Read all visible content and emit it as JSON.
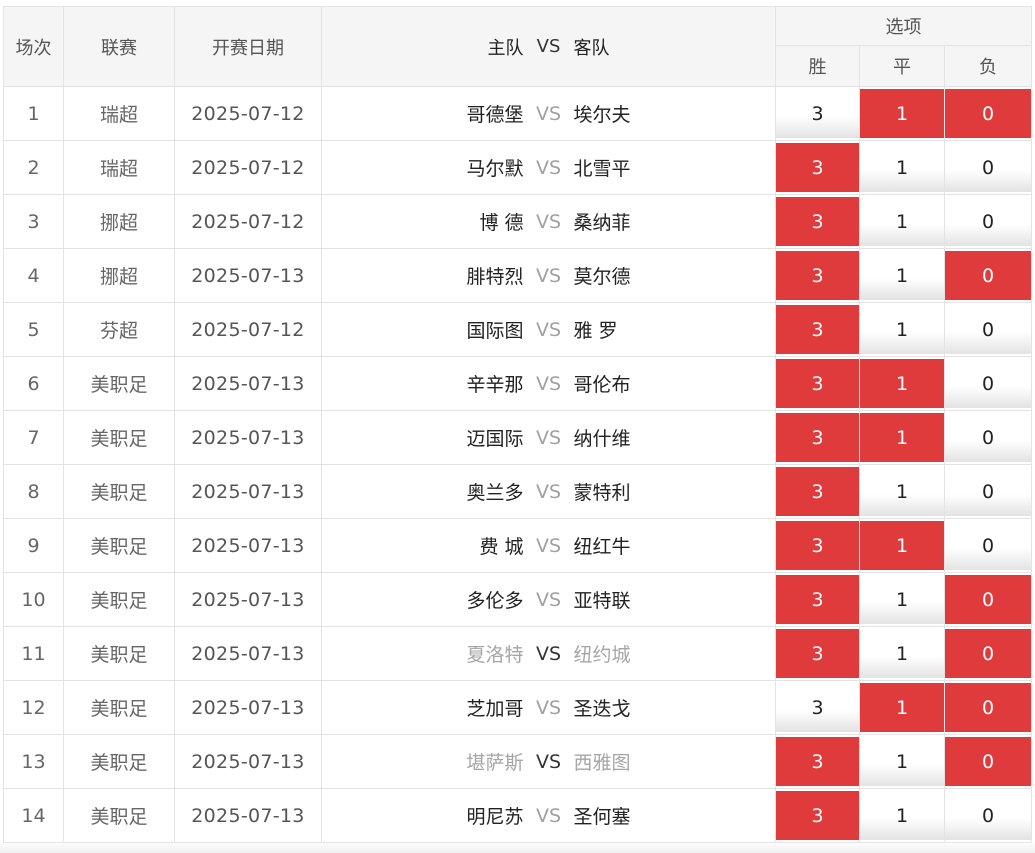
{
  "header": {
    "round": "场次",
    "league": "联赛",
    "date": "开赛日期",
    "home": "主队",
    "vs": "VS",
    "away": "客队",
    "options": "选项",
    "win": "胜",
    "draw": "平",
    "lose": "负"
  },
  "option_values": {
    "win": "3",
    "draw": "1",
    "lose": "0"
  },
  "colors": {
    "selected": "#df3b3c",
    "muted_team": "#a6a6a6"
  },
  "matches": [
    {
      "no": "1",
      "league": "瑞超",
      "date": "2025-07-12",
      "home": "哥德堡",
      "vs": "VS",
      "away": "埃尔夫",
      "muted": false,
      "selected": [
        "1",
        "0"
      ]
    },
    {
      "no": "2",
      "league": "瑞超",
      "date": "2025-07-12",
      "home": "马尔默",
      "vs": "VS",
      "away": "北雪平",
      "muted": false,
      "selected": [
        "3"
      ]
    },
    {
      "no": "3",
      "league": "挪超",
      "date": "2025-07-12",
      "home": "博 德",
      "vs": "VS",
      "away": "桑纳菲",
      "muted": false,
      "selected": [
        "3"
      ]
    },
    {
      "no": "4",
      "league": "挪超",
      "date": "2025-07-13",
      "home": "腓特烈",
      "vs": "VS",
      "away": "莫尔德",
      "muted": false,
      "selected": [
        "3",
        "0"
      ]
    },
    {
      "no": "5",
      "league": "芬超",
      "date": "2025-07-12",
      "home": "国际图",
      "vs": "VS",
      "away": "雅 罗",
      "muted": false,
      "selected": [
        "3"
      ]
    },
    {
      "no": "6",
      "league": "美职足",
      "date": "2025-07-13",
      "home": "辛辛那",
      "vs": "VS",
      "away": "哥伦布",
      "muted": false,
      "selected": [
        "3",
        "1"
      ]
    },
    {
      "no": "7",
      "league": "美职足",
      "date": "2025-07-13",
      "home": "迈国际",
      "vs": "VS",
      "away": "纳什维",
      "muted": false,
      "selected": [
        "3",
        "1"
      ]
    },
    {
      "no": "8",
      "league": "美职足",
      "date": "2025-07-13",
      "home": "奥兰多",
      "vs": "VS",
      "away": "蒙特利",
      "muted": false,
      "selected": [
        "3"
      ]
    },
    {
      "no": "9",
      "league": "美职足",
      "date": "2025-07-13",
      "home": "费 城",
      "vs": "VS",
      "away": "纽红牛",
      "muted": false,
      "selected": [
        "3",
        "1"
      ]
    },
    {
      "no": "10",
      "league": "美职足",
      "date": "2025-07-13",
      "home": "多伦多",
      "vs": "VS",
      "away": "亚特联",
      "muted": false,
      "selected": [
        "3",
        "0"
      ]
    },
    {
      "no": "11",
      "league": "美职足",
      "date": "2025-07-13",
      "home": "夏洛特",
      "vs": "VS",
      "away": "纽约城",
      "muted": true,
      "selected": [
        "3",
        "0"
      ]
    },
    {
      "no": "12",
      "league": "美职足",
      "date": "2025-07-13",
      "home": "芝加哥",
      "vs": "VS",
      "away": "圣迭戈",
      "muted": false,
      "selected": [
        "1",
        "0"
      ]
    },
    {
      "no": "13",
      "league": "美职足",
      "date": "2025-07-13",
      "home": "堪萨斯",
      "vs": "VS",
      "away": "西雅图",
      "muted": true,
      "selected": [
        "3",
        "0"
      ]
    },
    {
      "no": "14",
      "league": "美职足",
      "date": "2025-07-13",
      "home": "明尼苏",
      "vs": "VS",
      "away": "圣何塞",
      "muted": false,
      "selected": [
        "3"
      ]
    }
  ]
}
